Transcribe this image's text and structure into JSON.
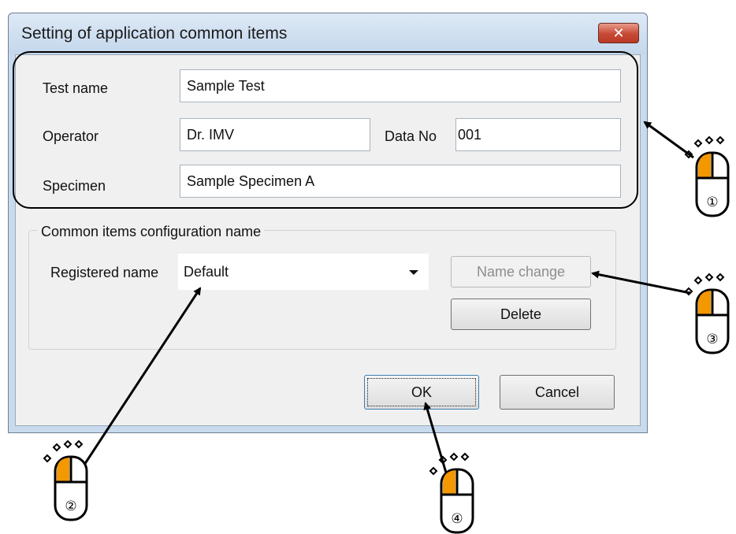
{
  "window": {
    "title": "Setting of application common items",
    "close_icon": "close-icon"
  },
  "fields": {
    "test_name_label": "Test name",
    "test_name_value": "Sample Test",
    "operator_label": "Operator",
    "operator_value": "Dr. IMV",
    "data_no_label": "Data No",
    "data_no_value": "001",
    "specimen_label": "Specimen",
    "specimen_value": "Sample Specimen A"
  },
  "config_group": {
    "legend": "Common items configuration name",
    "registered_name_label": "Registered name",
    "registered_name_value": "Default",
    "name_change_label": "Name change",
    "delete_label": "Delete"
  },
  "footer": {
    "ok_label": "OK",
    "cancel_label": "Cancel"
  },
  "callouts": [
    "①",
    "②",
    "③",
    "④"
  ],
  "colors": {
    "mouse_accent": "#f39800",
    "close_button": "#c74a35"
  }
}
